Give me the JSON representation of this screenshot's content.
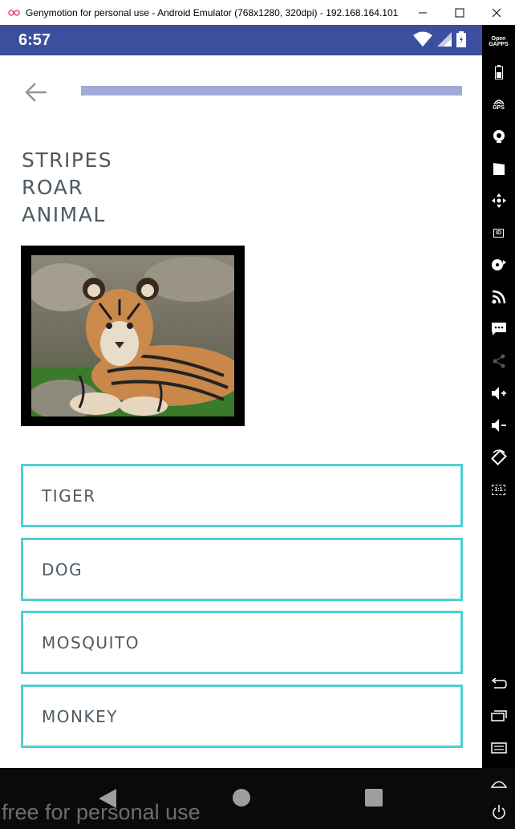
{
  "window": {
    "title": "Genymotion for personal use - Android Emulator (768x1280, 320dpi) - 192.168.164.101",
    "controls": [
      "minimize",
      "maximize",
      "close"
    ]
  },
  "status_bar": {
    "time": "6:57",
    "icons": [
      "wifi-icon",
      "signal-icon",
      "battery-icon"
    ],
    "color": "#3c4f9f"
  },
  "quiz": {
    "progress_fraction": 1.0,
    "clues": [
      "STRIPES",
      "ROAR",
      "ANIMAL"
    ],
    "options": [
      "TIGER",
      "DOG",
      "MOSQUITO",
      "MONKEY"
    ],
    "option_border_color": "#4fcfd0",
    "text_color": "#4e5a63",
    "progress_color": "#a3aad9"
  },
  "toolbar": {
    "opengapps_label": "Open GAPPS",
    "gps_label": "GPS",
    "id_label": "ID",
    "ratio_label": "1:1",
    "icons": [
      "opengapps-icon",
      "battery-icon",
      "gps-icon",
      "camera-icon",
      "capture-icon",
      "dpad-icon",
      "device-id-icon",
      "media-icon",
      "network-icon",
      "sms-icon",
      "share-icon",
      "volume-up-icon",
      "volume-down-icon",
      "rotate-icon",
      "pixel-perfect-icon",
      "back-icon",
      "recent-apps-icon",
      "menu-icon",
      "home-icon",
      "power-icon"
    ]
  },
  "watermark": "free for personal use"
}
